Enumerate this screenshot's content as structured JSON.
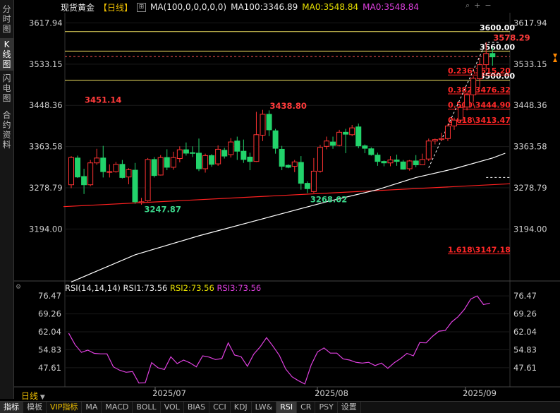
{
  "side_tabs": [
    "分时图",
    "K线图",
    "闪电图",
    "合约资料"
  ],
  "header": {
    "instrument": "现货黄金",
    "period": "【日线】",
    "ma_main": "MA(100,0,0,0,0,0)",
    "ma100": "MA100:3346.89",
    "ma0_a": "MA0:3548.84",
    "ma0_b": "MA0:3548.84"
  },
  "rsi_header": {
    "params": "RSI(14,14,14)",
    "rsi1": "RSI1:73.56",
    "rsi2": "RSI2:73.56",
    "rsi3": "RSI3:73.56"
  },
  "period_label": "日线",
  "bottom_tabs": [
    "指标",
    "模板",
    "VIP指标",
    "MA",
    "MACD",
    "BOLL",
    "VOL",
    "BIAS",
    "CCI",
    "KDJ",
    "LW&",
    "RSI",
    "CR",
    "PSY",
    "设置"
  ],
  "colors": {
    "up": "#ff3333",
    "down": "#22d36b",
    "ma100": "#ffffff",
    "trend": "#ff2020",
    "level": "#f0e060",
    "rsi": "#e040e0"
  },
  "chart_data": [
    {
      "type": "candlestick",
      "price_axis": {
        "ticks": [
          "3617.94",
          "3533.15",
          "3448.36",
          "3363.58",
          "3278.79",
          "3194.00"
        ],
        "range": [
          3090,
          3636
        ]
      },
      "x_labels": [
        "2025/07",
        "2025/08",
        "2025/09"
      ],
      "candles": [
        [
          3285,
          3344,
          3278,
          3341
        ],
        [
          3340,
          3345,
          3299,
          3301
        ],
        [
          3302,
          3318,
          3266,
          3285
        ],
        [
          3285,
          3336,
          3282,
          3330
        ],
        [
          3330,
          3359,
          3326,
          3340
        ],
        [
          3340,
          3365,
          3300,
          3312
        ],
        [
          3312,
          3327,
          3300,
          3312
        ],
        [
          3312,
          3332,
          3310,
          3327
        ],
        [
          3327,
          3336,
          3298,
          3300
        ],
        [
          3301,
          3319,
          3286,
          3316
        ],
        [
          3315,
          3330,
          3246,
          3250
        ],
        [
          3248,
          3258,
          3244,
          3250
        ],
        [
          3252,
          3340,
          3250,
          3337
        ],
        [
          3337,
          3342,
          3300,
          3304
        ],
        [
          3305,
          3346,
          3304,
          3341
        ],
        [
          3341,
          3358,
          3315,
          3321
        ],
        [
          3321,
          3353,
          3316,
          3341
        ],
        [
          3339,
          3364,
          3331,
          3357
        ],
        [
          3357,
          3372,
          3345,
          3350
        ],
        [
          3351,
          3364,
          3342,
          3350
        ],
        [
          3350,
          3380,
          3313,
          3318
        ],
        [
          3318,
          3349,
          3310,
          3345
        ],
        [
          3345,
          3348,
          3322,
          3327
        ],
        [
          3328,
          3366,
          3324,
          3358
        ],
        [
          3356,
          3361,
          3339,
          3344
        ],
        [
          3347,
          3381,
          3341,
          3373
        ],
        [
          3375,
          3384,
          3336,
          3354
        ],
        [
          3354,
          3378,
          3330,
          3337
        ],
        [
          3342,
          3351,
          3315,
          3333
        ],
        [
          3333,
          3435,
          3332,
          3388
        ],
        [
          3387,
          3439,
          3375,
          3430
        ],
        [
          3430,
          3438,
          3385,
          3398
        ],
        [
          3396,
          3400,
          3349,
          3360
        ],
        [
          3358,
          3365,
          3315,
          3323
        ],
        [
          3325,
          3327,
          3319,
          3321
        ],
        [
          3323,
          3336,
          3311,
          3332
        ],
        [
          3331,
          3344,
          3275,
          3288
        ],
        [
          3288,
          3292,
          3268,
          3277
        ],
        [
          3271,
          3340,
          3268,
          3313
        ],
        [
          3313,
          3367,
          3310,
          3362
        ],
        [
          3364,
          3384,
          3358,
          3375
        ],
        [
          3373,
          3384,
          3359,
          3366
        ],
        [
          3366,
          3398,
          3364,
          3393
        ],
        [
          3393,
          3400,
          3350,
          3389
        ],
        [
          3388,
          3408,
          3385,
          3402
        ],
        [
          3404,
          3411,
          3360,
          3365
        ],
        [
          3365,
          3368,
          3350,
          3360
        ],
        [
          3359,
          3362,
          3345,
          3347
        ],
        [
          3346,
          3351,
          3324,
          3333
        ],
        [
          3333,
          3335,
          3323,
          3330
        ],
        [
          3330,
          3344,
          3323,
          3336
        ],
        [
          3336,
          3347,
          3324,
          3333
        ],
        [
          3332,
          3336,
          3316,
          3317
        ],
        [
          3318,
          3336,
          3314,
          3334
        ],
        [
          3334,
          3346,
          3321,
          3326
        ],
        [
          3326,
          3349,
          3326,
          3337
        ],
        [
          3338,
          3380,
          3334,
          3375
        ],
        [
          3375,
          3380,
          3368,
          3378
        ],
        [
          3378,
          3392,
          3375,
          3380
        ],
        [
          3380,
          3410,
          3375,
          3406
        ],
        [
          3406,
          3423,
          3398,
          3418
        ],
        [
          3418,
          3448,
          3412,
          3444
        ],
        [
          3445,
          3475,
          3438,
          3470
        ],
        [
          3470,
          3508,
          3456,
          3504
        ],
        [
          3503,
          3546,
          3485,
          3532
        ],
        [
          3532,
          3578,
          3520,
          3555
        ],
        [
          3555,
          3567,
          3530,
          3548
        ]
      ],
      "ma100_polyline": [
        [
          0,
          3085
        ],
        [
          10,
          3141
        ],
        [
          20,
          3180
        ],
        [
          30,
          3215
        ],
        [
          40,
          3250
        ],
        [
          48,
          3275
        ],
        [
          54,
          3300
        ],
        [
          60,
          3318
        ],
        [
          66,
          3340
        ],
        [
          68,
          3350
        ]
      ],
      "horizontal_levels": [
        "3600.00",
        "3560.00",
        "3500.00"
      ],
      "fib_levels": [
        "0.236\\3515.20",
        "0.382\\3476.32",
        "0.500\\3444.90",
        "0.618\\3413.47",
        "1.618\\3147.18"
      ],
      "annotations": [
        "3451.14",
        "3438.80",
        "3578.29",
        "3247.87",
        "3268.02"
      ]
    },
    {
      "type": "line",
      "name": "RSI",
      "y_ticks": [
        "76.47",
        "69.26",
        "62.04",
        "54.83",
        "47.61"
      ],
      "range": [
        40.5,
        78.5
      ],
      "values": [
        61.5,
        56.9,
        53.8,
        54.7,
        53.4,
        53.2,
        53.2,
        48.0,
        46.6,
        45.8,
        46.1,
        41.5,
        41.6,
        49.7,
        47.6,
        46.9,
        52.0,
        49.3,
        50.7,
        49.6,
        48.0,
        52.4,
        51.9,
        50.9,
        51.3,
        57.6,
        52.7,
        52.1,
        48.2,
        53.1,
        56.0,
        59.7,
        56.3,
        52.6,
        47.1,
        44.0,
        42.4,
        41.1,
        48.8,
        54.0,
        55.6,
        53.5,
        53.5,
        51.2,
        50.7,
        49.8,
        49.5,
        49.8,
        48.5,
        49.5,
        47.4,
        49.6,
        51.3,
        53.4,
        52.4,
        57.7,
        57.6,
        60.2,
        62.3,
        62.6,
        66.0,
        68.1,
        71.1,
        75.2,
        76.5,
        73.0,
        73.6
      ]
    }
  ]
}
